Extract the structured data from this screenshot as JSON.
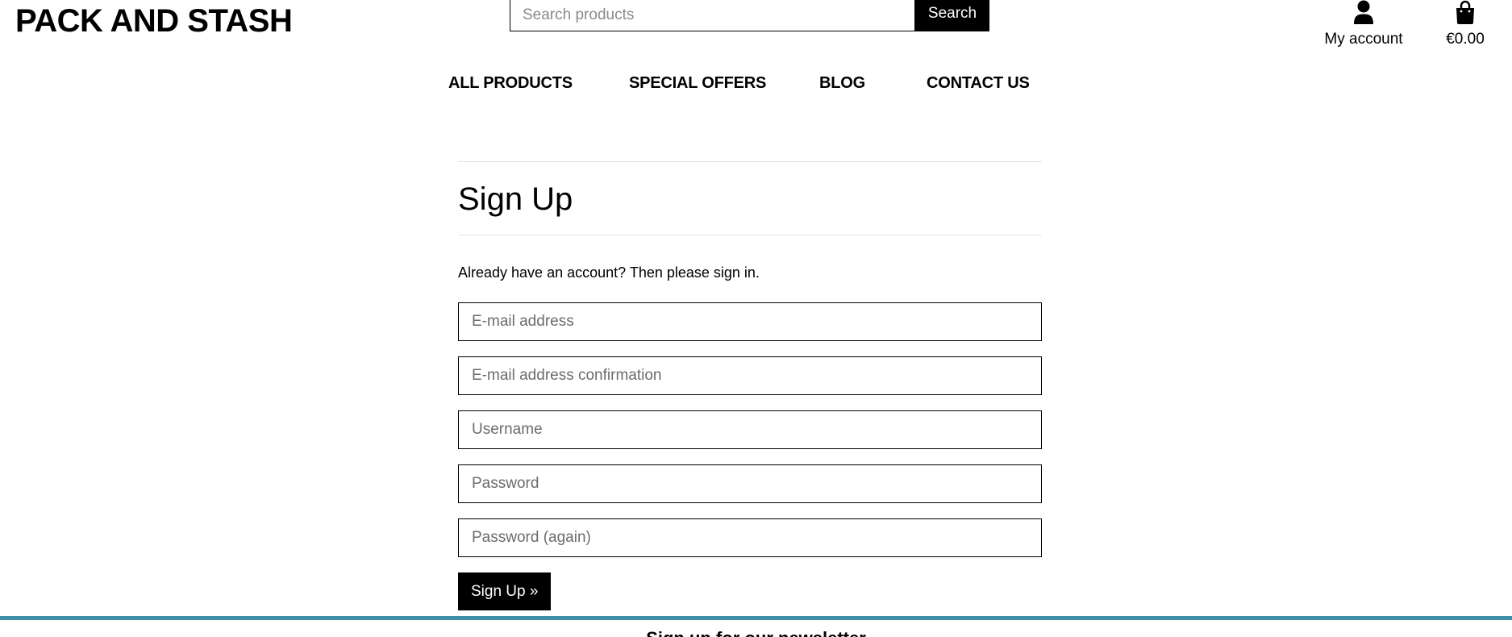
{
  "header": {
    "brand": "PACK AND STASH",
    "search": {
      "placeholder": "Search products",
      "button_label": "Search"
    },
    "account_label": "My account",
    "cart_total": "€0.00",
    "icons": {
      "account": "user-icon",
      "cart": "shopping-bag-icon"
    }
  },
  "nav": {
    "items": [
      {
        "label": "ALL PRODUCTS"
      },
      {
        "label": "SPECIAL OFFERS"
      },
      {
        "label": "BLOG"
      },
      {
        "label": "CONTACT US"
      }
    ]
  },
  "signup": {
    "title": "Sign Up",
    "note": "Already have an account? Then please sign in.",
    "fields": {
      "email": {
        "placeholder": "E-mail address",
        "value": ""
      },
      "email_confirm": {
        "placeholder": "E-mail address confirmation",
        "value": ""
      },
      "username": {
        "placeholder": "Username",
        "value": ""
      },
      "password": {
        "placeholder": "Password",
        "value": ""
      },
      "password_again": {
        "placeholder": "Password (again)",
        "value": ""
      }
    },
    "submit_label": "Sign Up »"
  },
  "footer": {
    "newsletter_title": "Sign up for our newsletter"
  },
  "colors": {
    "accent": "#3f8fa8",
    "primary": "#000000",
    "divider": "#e3e3e3"
  }
}
